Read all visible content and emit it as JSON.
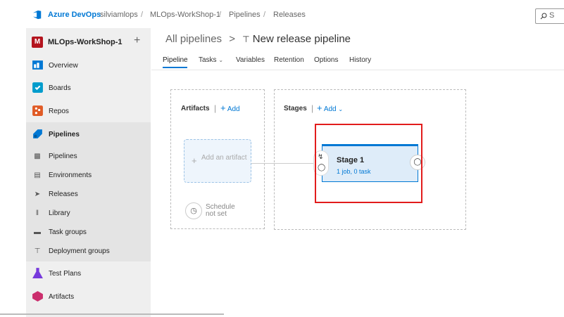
{
  "topbar": {
    "brand": "Azure DevOps",
    "org": "silviamlops",
    "project": "MLOps-WorkShop-1",
    "section": "Pipelines",
    "page": "Releases",
    "separator": "/"
  },
  "sidebar": {
    "project_initial": "M",
    "project_name": "MLOps-WorkShop-1",
    "add_symbol": "+",
    "items": [
      {
        "label": "Overview",
        "icon": "overview-icon",
        "color": "#0078d4"
      },
      {
        "label": "Boards",
        "icon": "boards-icon",
        "color": "#009ccc"
      },
      {
        "label": "Repos",
        "icon": "repos-icon",
        "color": "#e05b25"
      },
      {
        "label": "Pipelines",
        "icon": "pipelines-icon",
        "color": "#0078d4"
      },
      {
        "label": "Test Plans",
        "icon": "test-plans-icon",
        "color": "#773adc"
      },
      {
        "label": "Artifacts",
        "icon": "artifacts-icon",
        "color": "#cb2e6d"
      }
    ],
    "sub_items": [
      {
        "label": "Pipelines",
        "icon": "pipelines-sub-icon"
      },
      {
        "label": "Environments",
        "icon": "environments-icon"
      },
      {
        "label": "Releases",
        "icon": "releases-icon"
      },
      {
        "label": "Library",
        "icon": "library-icon"
      },
      {
        "label": "Task groups",
        "icon": "task-groups-icon"
      },
      {
        "label": "Deployment groups",
        "icon": "deployment-groups-icon"
      }
    ]
  },
  "main": {
    "breadcrumb_parent": "All pipelines",
    "breadcrumb_arrow": ">",
    "title": "New release pipeline",
    "tabs": [
      "Pipeline",
      "Tasks",
      "Variables",
      "Retention",
      "Options",
      "History"
    ],
    "active_tab": "Pipeline"
  },
  "artifacts": {
    "title": "Artifacts",
    "add_label": "Add",
    "add_artifact_label": "Add an artifact",
    "schedule_label": "Schedule not set"
  },
  "stages": {
    "title": "Stages",
    "add_label": "Add",
    "stage_name": "Stage 1",
    "stage_summary": "1 job, 0 task"
  },
  "accent_color": "#0078d4",
  "highlight_color": "#e21c1c"
}
